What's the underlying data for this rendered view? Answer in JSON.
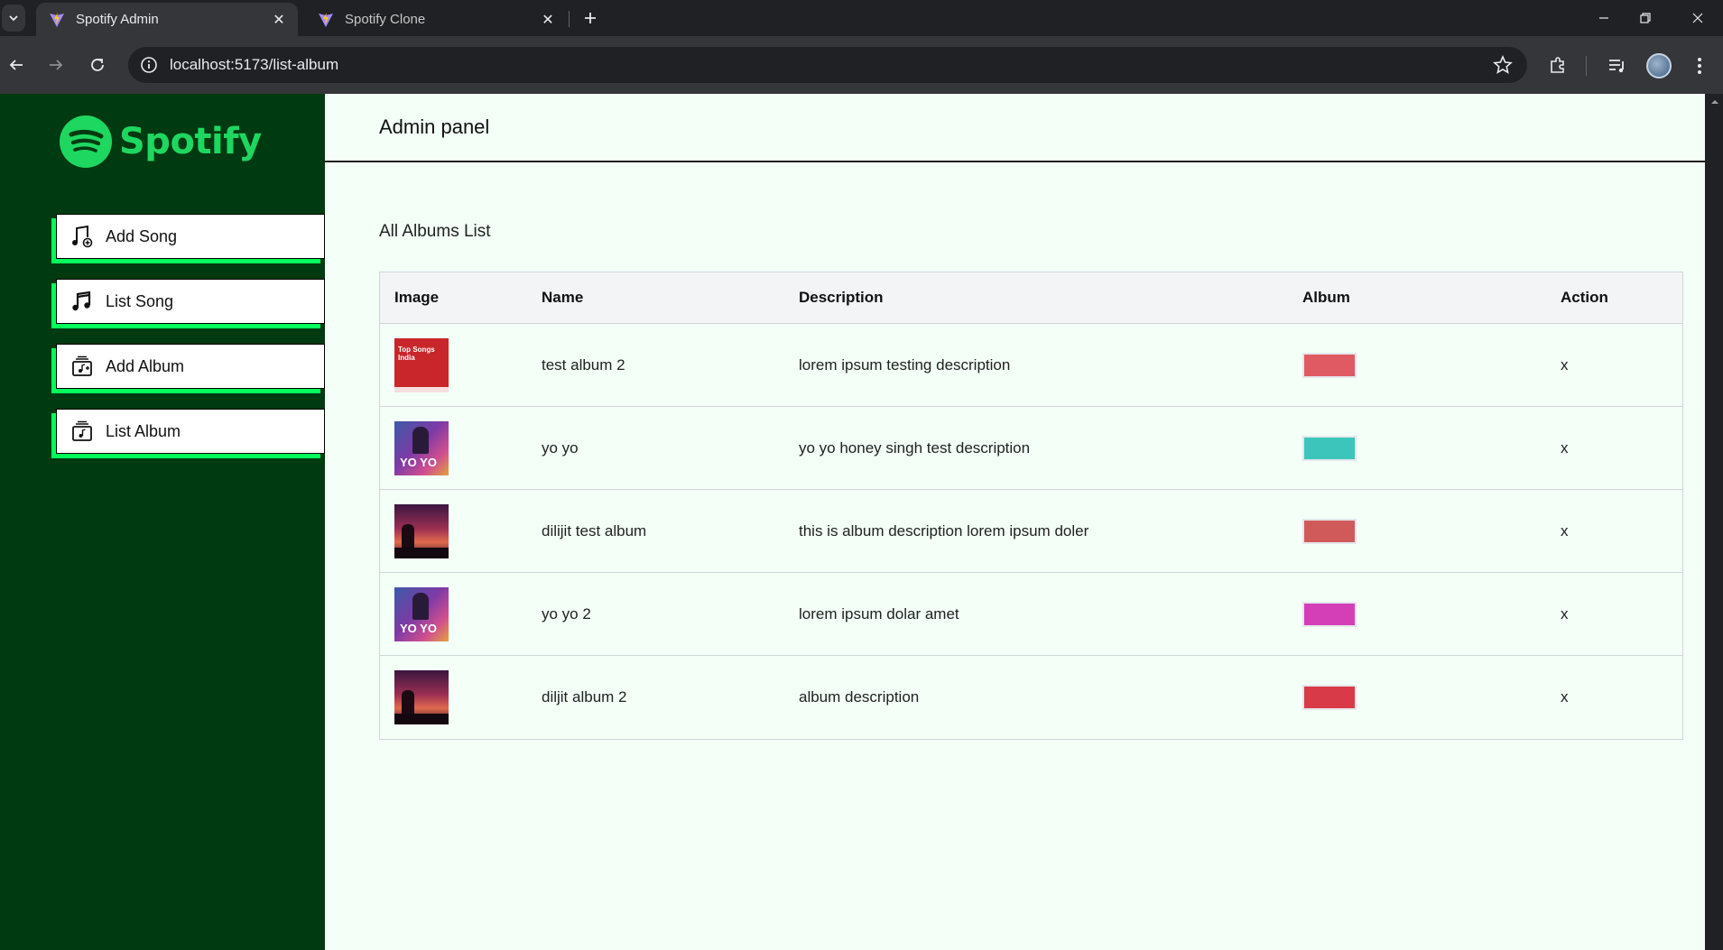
{
  "browser": {
    "tabs": [
      {
        "title": "Spotify Admin",
        "active": true
      },
      {
        "title": "Spotify Clone",
        "active": false
      }
    ],
    "url": "localhost:5173/list-album"
  },
  "sidebar": {
    "logo_text": "Spotify",
    "items": [
      {
        "label": "Add Song",
        "icon": "add-song-icon"
      },
      {
        "label": "List Song",
        "icon": "music-note-icon"
      },
      {
        "label": "Add Album",
        "icon": "add-album-icon"
      },
      {
        "label": "List Album",
        "icon": "album-list-icon"
      }
    ]
  },
  "header": {
    "title": "Admin panel"
  },
  "main": {
    "title": "All Albums List",
    "columns": [
      "Image",
      "Name",
      "Description",
      "Album",
      "Action"
    ],
    "rows": [
      {
        "name": "test album 2",
        "description": "lorem ipsum testing description",
        "color": "#e05a63",
        "action": "x",
        "thumb_text": "Top Songs India"
      },
      {
        "name": "yo yo",
        "description": "yo yo honey singh test description",
        "color": "#3cc6bb",
        "action": "x",
        "thumb_text": "YO YO"
      },
      {
        "name": "dilijit test album",
        "description": "this is album description lorem ipsum doler",
        "color": "#d05a5a",
        "action": "x",
        "thumb_text": ""
      },
      {
        "name": "yo yo 2",
        "description": "lorem ipsum dolar amet",
        "color": "#d43fb8",
        "action": "x",
        "thumb_text": "YO YO"
      },
      {
        "name": "diljit album 2",
        "description": "album description",
        "color": "#d83a48",
        "action": "x",
        "thumb_text": ""
      }
    ]
  },
  "colors": {
    "sidebar_bg": "#003a10",
    "main_bg": "#f3fff7",
    "brand_green": "#1ed760",
    "menu_accent": "#00ff5b"
  }
}
